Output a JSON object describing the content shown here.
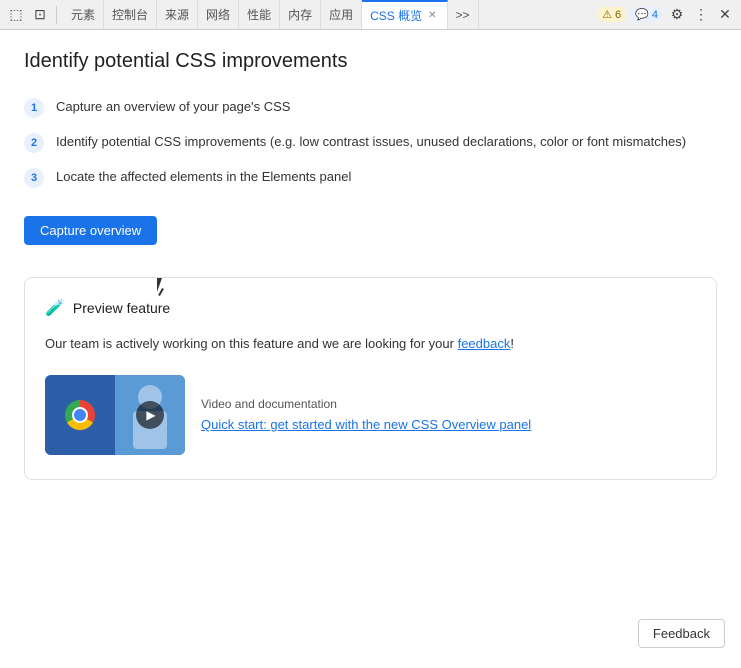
{
  "toolbar": {
    "icons": [
      {
        "name": "inspect-icon",
        "symbol": "⬚"
      },
      {
        "name": "device-icon",
        "symbol": "⊡"
      }
    ],
    "tabs": [
      {
        "id": "elements",
        "label": "元素",
        "active": false
      },
      {
        "id": "console",
        "label": "控制台",
        "active": false
      },
      {
        "id": "sources",
        "label": "来源",
        "active": false
      },
      {
        "id": "network",
        "label": "网络",
        "active": false
      },
      {
        "id": "performance",
        "label": "性能",
        "active": false
      },
      {
        "id": "memory",
        "label": "内存",
        "active": false
      },
      {
        "id": "application",
        "label": "应用",
        "active": false
      },
      {
        "id": "css-overview",
        "label": "CSS 概览",
        "active": true,
        "closable": true
      }
    ],
    "more_tabs": ">>",
    "warning_badge": "⚠ 6",
    "info_badge": "💬 4",
    "settings_icon": "⚙",
    "more_icon": "⋮",
    "close_icon": "✕"
  },
  "page": {
    "title": "Identify potential CSS improvements",
    "steps": [
      {
        "number": "1",
        "text": "Capture an overview of your page's CSS"
      },
      {
        "number": "2",
        "text": "Identify potential CSS improvements (e.g. low contrast issues, unused declarations, color or font mismatches)"
      },
      {
        "number": "3",
        "text": "Locate the affected elements in the Elements panel"
      }
    ],
    "capture_button": "Capture overview",
    "preview_card": {
      "icon": "🧪",
      "title": "Preview feature",
      "description_before": "Our team is actively working on this feature and we are looking for your ",
      "feedback_link": "feedback",
      "description_after": "!",
      "video_label": "Video and documentation",
      "video_link": "Quick start: get started with the new CSS Overview panel"
    },
    "feedback_button": "Feedback"
  }
}
